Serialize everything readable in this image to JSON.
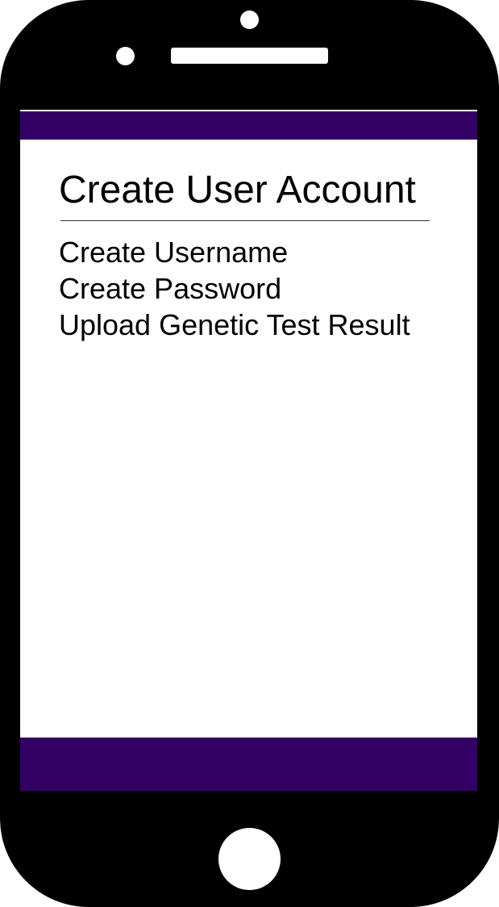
{
  "screen": {
    "title": "Create User Account",
    "menu_items": [
      {
        "label": "Create Username"
      },
      {
        "label": "Create Password"
      },
      {
        "label": "Upload Genetic Test Result"
      }
    ]
  },
  "colors": {
    "phone_body": "#000000",
    "brand_bar": "#330066",
    "screen_bg": "#ffffff",
    "text": "#000000"
  },
  "icons": {
    "front_camera": "front-camera-icon",
    "sensor": "sensor-icon",
    "speaker": "speaker-grille",
    "home": "home-button"
  }
}
